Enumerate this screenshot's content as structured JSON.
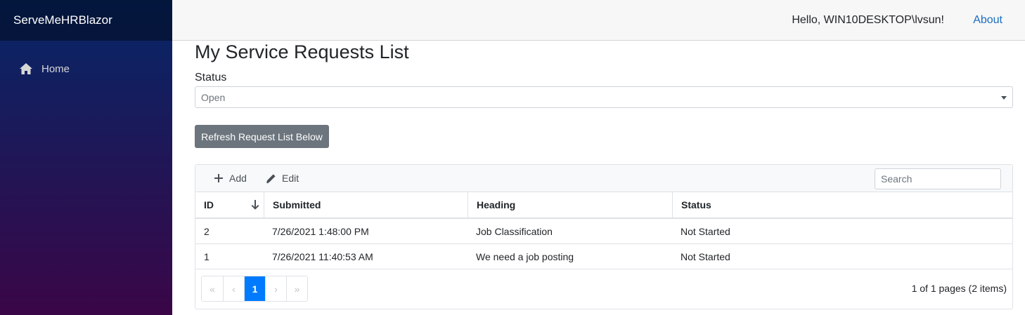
{
  "app": {
    "brand": "ServeMeHRBlazor"
  },
  "sidebar": {
    "items": [
      {
        "label": "Home",
        "icon": "home-icon"
      }
    ]
  },
  "topbar": {
    "greeting": "Hello, WIN10DESKTOP\\lvsun!",
    "about_label": "About"
  },
  "page": {
    "title": "My Service Requests List"
  },
  "status_filter": {
    "label": "Status",
    "selected": "Open"
  },
  "refresh_button": {
    "label": "Refresh Request List Below"
  },
  "grid": {
    "toolbar": {
      "add_label": "Add",
      "edit_label": "Edit",
      "search_placeholder": "Search"
    },
    "columns": [
      "ID",
      "Submitted",
      "Heading",
      "Status"
    ],
    "sort": {
      "column": "ID",
      "direction": "descending"
    },
    "rows": [
      {
        "id": "2",
        "submitted": "7/26/2021 1:48:00 PM",
        "heading": "Job Classification",
        "status": "Not Started"
      },
      {
        "id": "1",
        "submitted": "7/26/2021 11:40:53 AM",
        "heading": "We need a job posting",
        "status": "Not Started"
      }
    ],
    "pager": {
      "first": "«",
      "prev": "‹",
      "current_page": "1",
      "next": "›",
      "last": "»",
      "summary": "1 of 1 pages (2 items)"
    }
  },
  "colors": {
    "accent": "#007bff",
    "link": "#1b6ec2",
    "sidebar_top": "#052767",
    "sidebar_bottom": "#3a0647",
    "secondary_button": "#6c757d"
  }
}
